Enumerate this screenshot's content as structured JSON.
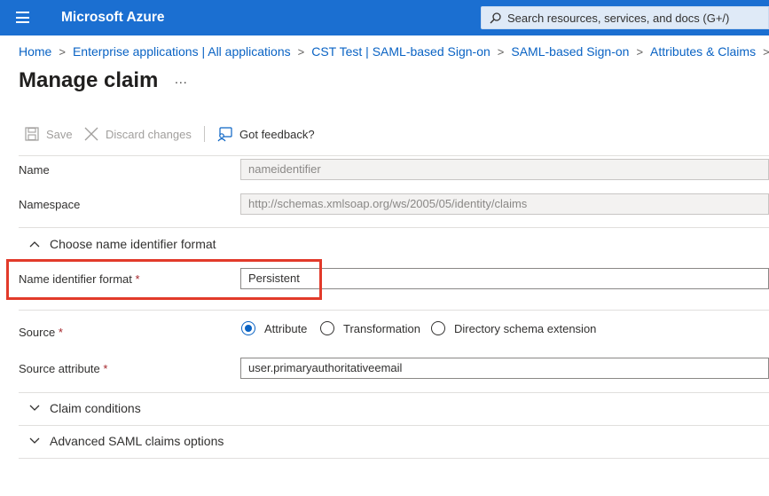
{
  "topbar": {
    "brand": "Microsoft Azure",
    "search_placeholder": "Search resources, services, and docs (G+/)"
  },
  "breadcrumb": {
    "items": [
      "Home",
      "Enterprise applications | All applications",
      "CST Test | SAML-based Sign-on",
      "SAML-based Sign-on",
      "Attributes & Claims"
    ],
    "separator": ">"
  },
  "page": {
    "title": "Manage claim",
    "more": "..."
  },
  "toolbar": {
    "save": "Save",
    "discard": "Discard changes",
    "feedback": "Got feedback?"
  },
  "form": {
    "name_label": "Name",
    "name_value": "nameidentifier",
    "namespace_label": "Namespace",
    "namespace_value": "http://schemas.xmlsoap.org/ws/2005/05/identity/claims",
    "choose_format_section": "Choose name identifier format",
    "name_id_format_label": "Name identifier format",
    "name_id_format_value": "Persistent",
    "required_marker": "*",
    "source_label": "Source",
    "source_options": [
      "Attribute",
      "Transformation",
      "Directory schema extension"
    ],
    "source_selected": "Attribute",
    "source_attribute_label": "Source attribute",
    "source_attribute_value": "user.primaryauthoritativeemail",
    "claim_conditions_section": "Claim conditions",
    "advanced_section": "Advanced SAML claims options"
  },
  "colors": {
    "topbar": "#1b6fd1",
    "link": "#0a63c4",
    "required": "#a4262c",
    "highlight": "#e23a2a"
  }
}
